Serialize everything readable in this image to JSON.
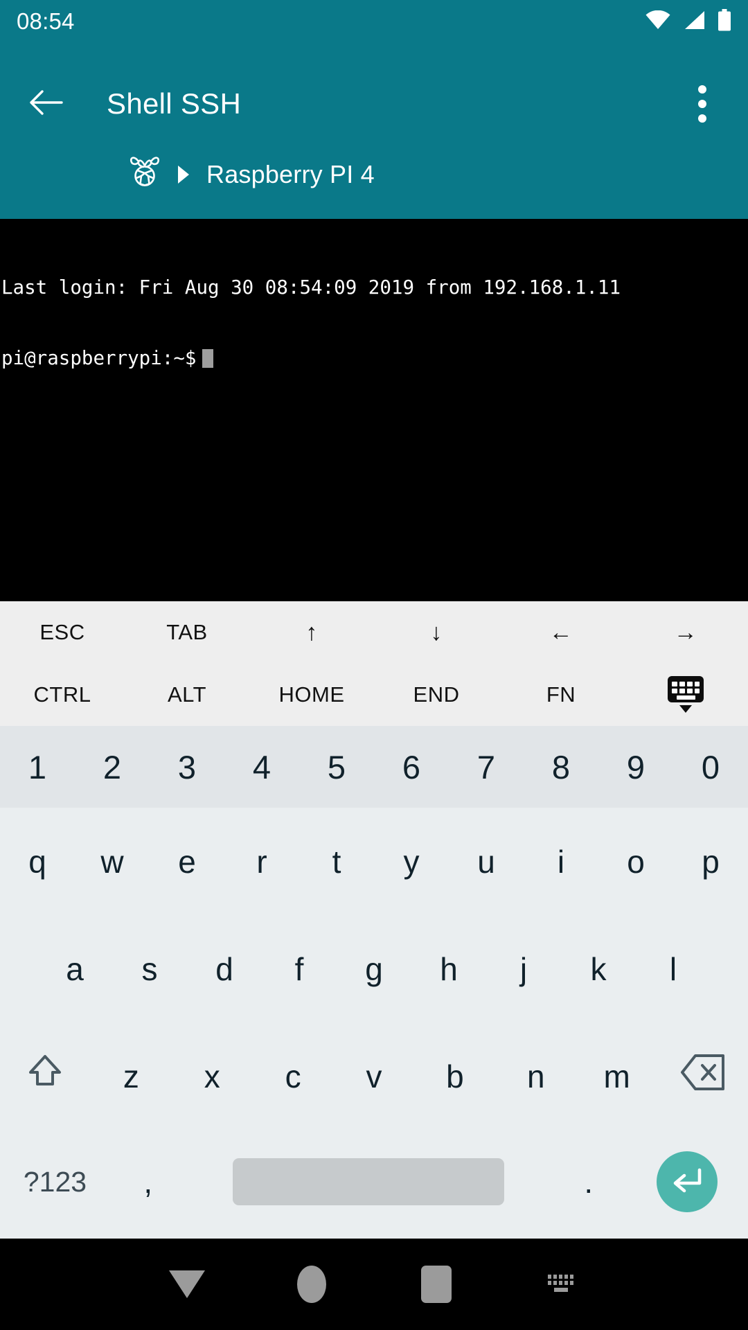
{
  "status_bar": {
    "time": "08:54",
    "icons": [
      "wifi-icon",
      "signal-icon",
      "battery-icon"
    ]
  },
  "app_bar": {
    "back_icon": "back-arrow-icon",
    "title": "Shell SSH",
    "overflow_icon": "overflow-menu-icon",
    "breadcrumb": {
      "logo_icon": "raspberry-pi-icon",
      "separator_icon": "triangle-right-icon",
      "host_label": "Raspberry PI 4"
    }
  },
  "terminal": {
    "line1": "Last login: Fri Aug 30 08:54:09 2019 from 192.168.1.11",
    "line2": "pi@raspberrypi:~$",
    "cursor": "block-cursor"
  },
  "function_bar": {
    "row1": [
      {
        "label": "ESC",
        "name": "esc"
      },
      {
        "label": "TAB",
        "name": "tab"
      },
      {
        "label": "↑",
        "name": "arrow-up"
      },
      {
        "label": "↓",
        "name": "arrow-down"
      },
      {
        "label": "←",
        "name": "arrow-left"
      },
      {
        "label": "→",
        "name": "arrow-right"
      }
    ],
    "row2": [
      {
        "label": "CTRL",
        "name": "ctrl"
      },
      {
        "label": "ALT",
        "name": "alt"
      },
      {
        "label": "HOME",
        "name": "home"
      },
      {
        "label": "END",
        "name": "end"
      },
      {
        "label": "FN",
        "name": "fn"
      },
      {
        "label": "",
        "name": "hide-keyboard"
      }
    ]
  },
  "keyboard": {
    "number_row": [
      "1",
      "2",
      "3",
      "4",
      "5",
      "6",
      "7",
      "8",
      "9",
      "0"
    ],
    "row_top": [
      "q",
      "w",
      "e",
      "r",
      "t",
      "y",
      "u",
      "i",
      "o",
      "p"
    ],
    "row_mid": [
      "a",
      "s",
      "d",
      "f",
      "g",
      "h",
      "j",
      "k",
      "l"
    ],
    "row_bot": [
      "z",
      "x",
      "c",
      "v",
      "b",
      "n",
      "m"
    ],
    "shift_icon": "shift-icon",
    "backspace_icon": "backspace-icon",
    "symbols_label": "?123",
    "comma_label": ",",
    "space_label": "",
    "period_label": ".",
    "enter_icon": "enter-icon"
  },
  "nav_bar": {
    "back_icon": "nav-down-icon",
    "home_icon": "nav-home-icon",
    "recents_icon": "nav-recents-icon",
    "ime_switch_icon": "ime-switcher-icon"
  },
  "colors": {
    "primary_teal": "#0a7989",
    "enter_teal": "#4db6ac",
    "terminal_bg": "#000000",
    "fn_bar_bg": "#eeeeee",
    "keyboard_bg": "#eaeef0",
    "number_row_bg": "#e1e5e8",
    "key_text": "#10212b",
    "spacebar": "#c6cacc",
    "nav_icon": "#9b9b9b"
  }
}
